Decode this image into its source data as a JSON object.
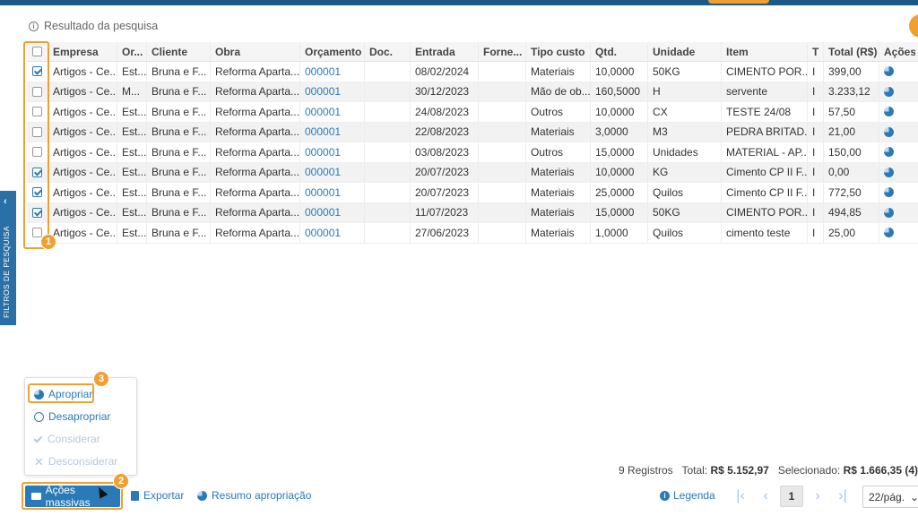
{
  "section_title": "Resultado da pesquisa",
  "side_panel_label": "FILTROS DE PESQUISA",
  "columns": [
    "",
    "Empresa",
    "Or...",
    "Cliente",
    "Obra",
    "Orçamento",
    "Doc.",
    "Entrada",
    "Forne...",
    "Tipo custo",
    "Qtd.",
    "Unidade",
    "Item",
    "T",
    "Total (R$)",
    "Ações"
  ],
  "rows": [
    {
      "checked": true,
      "empresa": "Artigos - Ce...",
      "or": "Est...",
      "cliente": "Bruna e F...",
      "obra": "Reforma Aparta...",
      "orcamento": "000001",
      "doc": "",
      "entrada": "08/02/2024",
      "fornecedor": "",
      "tipo_custo": "Materiais",
      "qtd": "10,0000",
      "unidade": "50KG",
      "item": "CIMENTO POR...",
      "t": "I",
      "total": "399,00"
    },
    {
      "checked": false,
      "empresa": "Artigos - Ce...",
      "or": "M...",
      "cliente": "Bruna e F...",
      "obra": "Reforma Aparta...",
      "orcamento": "000001",
      "doc": "",
      "entrada": "30/12/2023",
      "fornecedor": "",
      "tipo_custo": "Mão de ob...",
      "qtd": "160,5000",
      "unidade": "H",
      "item": "servente",
      "t": "I",
      "total": "3.233,12"
    },
    {
      "checked": false,
      "empresa": "Artigos - Ce...",
      "or": "Est...",
      "cliente": "Bruna e F...",
      "obra": "Reforma Aparta...",
      "orcamento": "000001",
      "doc": "",
      "entrada": "24/08/2023",
      "fornecedor": "",
      "tipo_custo": "Outros",
      "qtd": "10,0000",
      "unidade": "CX",
      "item": "TESTE 24/08",
      "t": "I",
      "total": "57,50"
    },
    {
      "checked": false,
      "empresa": "Artigos - Ce...",
      "or": "Est...",
      "cliente": "Bruna e F...",
      "obra": "Reforma Aparta...",
      "orcamento": "000001",
      "doc": "",
      "entrada": "22/08/2023",
      "fornecedor": "",
      "tipo_custo": "Materiais",
      "qtd": "3,0000",
      "unidade": "M3",
      "item": "PEDRA BRITAD...",
      "t": "I",
      "total": "21,00"
    },
    {
      "checked": false,
      "empresa": "Artigos - Ce...",
      "or": "Est...",
      "cliente": "Bruna e F...",
      "obra": "Reforma Aparta...",
      "orcamento": "000001",
      "doc": "",
      "entrada": "03/08/2023",
      "fornecedor": "",
      "tipo_custo": "Outros",
      "qtd": "15,0000",
      "unidade": "Unidades",
      "item": "MATERIAL - AP...",
      "t": "I",
      "total": "150,00"
    },
    {
      "checked": true,
      "empresa": "Artigos - Ce...",
      "or": "Est...",
      "cliente": "Bruna e F...",
      "obra": "Reforma Aparta...",
      "orcamento": "000001",
      "doc": "",
      "entrada": "20/07/2023",
      "fornecedor": "",
      "tipo_custo": "Materiais",
      "qtd": "10,0000",
      "unidade": "KG",
      "item": "Cimento CP II F...",
      "t": "I",
      "total": "0,00"
    },
    {
      "checked": true,
      "empresa": "Artigos - Ce...",
      "or": "Est...",
      "cliente": "Bruna e F...",
      "obra": "Reforma Aparta...",
      "orcamento": "000001",
      "doc": "",
      "entrada": "20/07/2023",
      "fornecedor": "",
      "tipo_custo": "Materiais",
      "qtd": "25,0000",
      "unidade": "Quilos",
      "item": "Cimento CP II F...",
      "t": "I",
      "total": "772,50"
    },
    {
      "checked": true,
      "empresa": "Artigos - Ce...",
      "or": "Est...",
      "cliente": "Bruna e F...",
      "obra": "Reforma Aparta...",
      "orcamento": "000001",
      "doc": "",
      "entrada": "11/07/2023",
      "fornecedor": "",
      "tipo_custo": "Materiais",
      "qtd": "15,0000",
      "unidade": "50KG",
      "item": "CIMENTO POR...",
      "t": "I",
      "total": "494,85"
    },
    {
      "checked": false,
      "empresa": "Artigos - Ce...",
      "or": "Est...",
      "cliente": "Bruna e F...",
      "obra": "Reforma Aparta...",
      "orcamento": "000001",
      "doc": "",
      "entrada": "27/06/2023",
      "fornecedor": "",
      "tipo_custo": "Materiais",
      "qtd": "1,0000",
      "unidade": "Quilos",
      "item": "cimento teste",
      "t": "I",
      "total": "25,00"
    }
  ],
  "badges": [
    "1",
    "2",
    "3"
  ],
  "mass_actions_menu": [
    {
      "label": "Apropriar",
      "enabled": true,
      "icon": "pie-icon"
    },
    {
      "label": "Desapropriar",
      "enabled": true,
      "icon": "circle-icon"
    },
    {
      "label": "Considerar",
      "enabled": false,
      "icon": "check-icon"
    },
    {
      "label": "Desconsiderar",
      "enabled": false,
      "icon": "x-icon"
    }
  ],
  "toolbar": {
    "mass_actions_label": "Ações massivas",
    "export_label": "Exportar",
    "summary_label": "Resumo apropriação"
  },
  "summary": {
    "records": "9 Registros",
    "total_label": "Total:",
    "total_value": "R$ 5.152,97",
    "selected_label": "Selecionado:",
    "selected_value": "R$ 1.666,35 (4)"
  },
  "legend_label": "Legenda",
  "pagination": {
    "current_page": "1",
    "per_page": "22/pág."
  },
  "colors": {
    "accent": "#2a7ab8",
    "highlight": "#f0a030",
    "header_bar": "#1c5a86"
  }
}
